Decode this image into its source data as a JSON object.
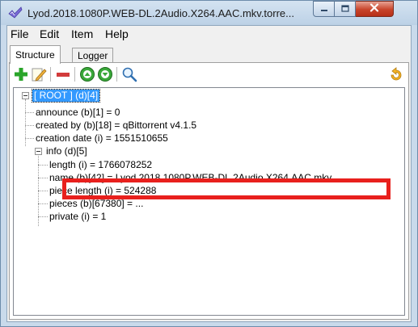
{
  "window": {
    "title": "Lyod.2018.1080P.WEB-DL.2Audio.X264.AAC.mkv.torre...",
    "app_icon": "torrent-check-icon",
    "controls": {
      "minimize": "minimize-icon",
      "maximize": "maximize-icon",
      "close": "close-icon"
    }
  },
  "menu": {
    "items": [
      {
        "label": "File"
      },
      {
        "label": "Edit"
      },
      {
        "label": "Item"
      },
      {
        "label": "Help"
      }
    ]
  },
  "tabs": [
    {
      "label": "Structure",
      "active": true
    },
    {
      "label": "Logger",
      "active": false
    }
  ],
  "toolbar": {
    "buttons": [
      {
        "icon": "add-icon"
      },
      {
        "icon": "edit-icon"
      },
      {
        "icon": "remove-icon"
      },
      {
        "icon": "move-up-icon"
      },
      {
        "icon": "move-down-icon"
      },
      {
        "icon": "search-icon"
      },
      {
        "icon": "undo-icon"
      }
    ]
  },
  "tree": {
    "root": {
      "label": "[ ROOT ] (d)[4]",
      "selected": true
    },
    "nodes": [
      {
        "label": "announce (b)[1] = 0"
      },
      {
        "label": "created by (b)[18] = qBittorrent v4.1.5"
      },
      {
        "label": "creation date (i) = 1551510655"
      },
      {
        "label": "info (d)[5]"
      },
      {
        "label": "length (i) = 1766078252"
      },
      {
        "label": "name (b)[42] = Lyod.2018.1080P.WEB-DL.2Audio.X264.AAC.mkv"
      },
      {
        "label": "piece length (i) = 524288"
      },
      {
        "label": "pieces (b)[67380] = ..."
      },
      {
        "label": "private (i) = 1"
      }
    ]
  },
  "colors": {
    "selection": "#3399ff",
    "highlight_box": "#e8201d",
    "add": "#2aa52a",
    "remove": "#d23b3b",
    "move": "#3aa83a"
  }
}
